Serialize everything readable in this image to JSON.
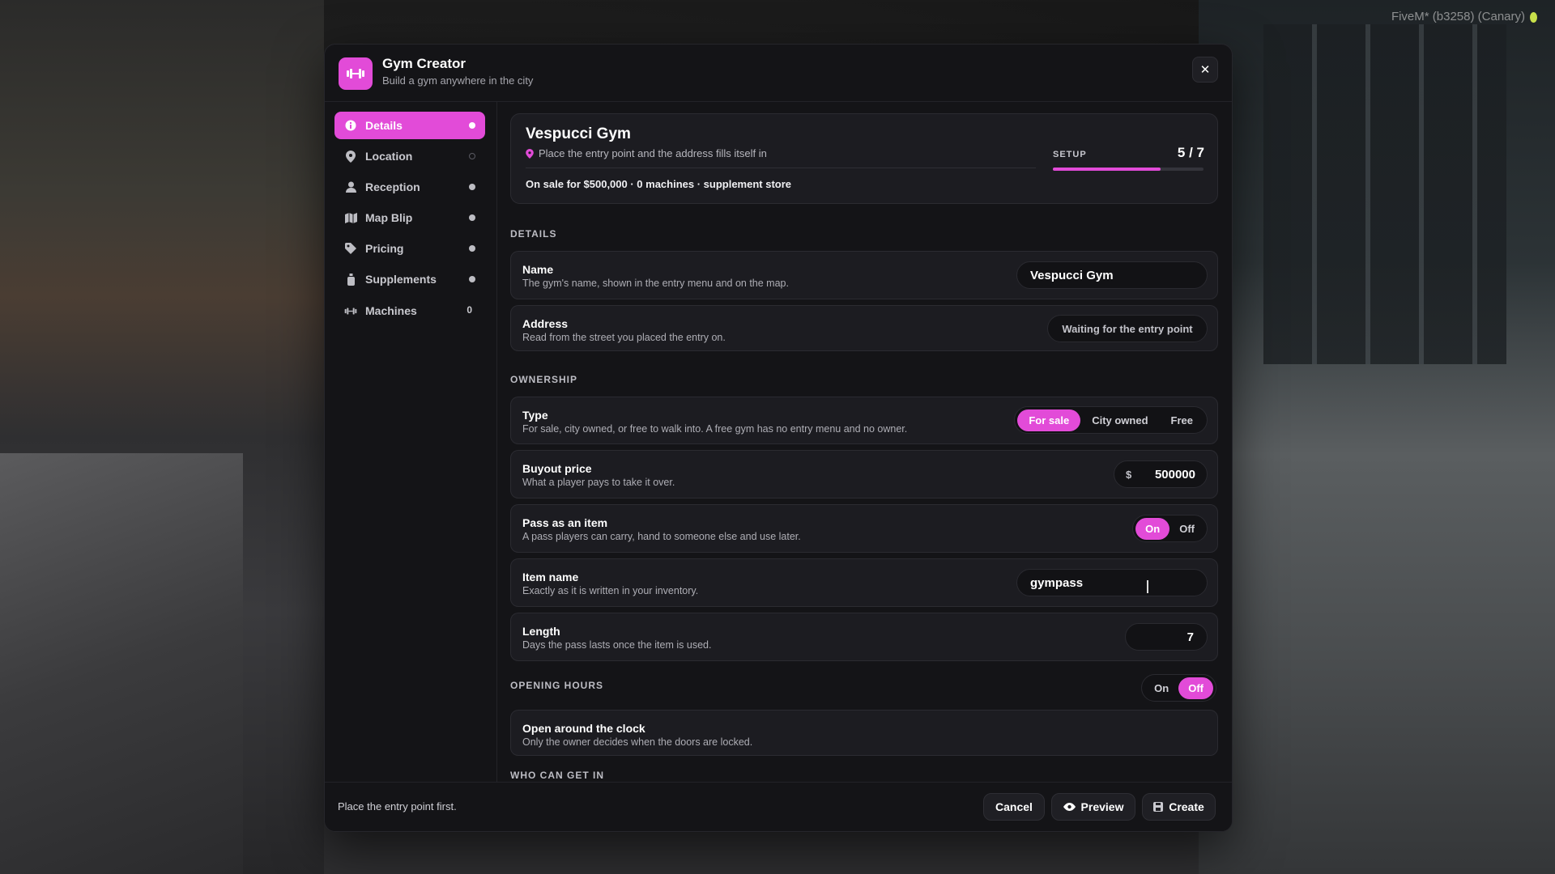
{
  "overlay": {
    "client": "FiveM* (b3258) (Canary)"
  },
  "header": {
    "logo_icon": "dumbbell-icon",
    "title": "Gym Creator",
    "subtitle": "Build a gym anywhere in the city",
    "close_label": "✕"
  },
  "sidebar": {
    "items": [
      {
        "label": "Details",
        "icon": "info-icon",
        "state": "active"
      },
      {
        "label": "Location",
        "icon": "pin-icon",
        "state": "empty"
      },
      {
        "label": "Reception",
        "icon": "person-icon",
        "state": "done"
      },
      {
        "label": "Map Blip",
        "icon": "map-icon",
        "state": "done"
      },
      {
        "label": "Pricing",
        "icon": "tag-icon",
        "state": "done"
      },
      {
        "label": "Supplements",
        "icon": "bottle-icon",
        "state": "done"
      },
      {
        "label": "Machines",
        "icon": "dumbbell-icon",
        "count": "0"
      }
    ]
  },
  "summary": {
    "title": "Vespucci Gym",
    "hint": "Place the entry point and the address fills itself in",
    "meta": "On sale for $500,000 · 0 machines · supplement store",
    "setup_label": "SETUP",
    "setup_count": "5 / 7",
    "progress": 0.714
  },
  "sections": {
    "details": "DETAILS",
    "ownership": "OWNERSHIP",
    "hours": "OPENING HOURS",
    "access": "WHO CAN GET IN"
  },
  "details": {
    "name": {
      "label": "Name",
      "desc": "The gym's name, shown in the entry menu and on the map.",
      "value": "Vespucci Gym"
    },
    "address": {
      "label": "Address",
      "desc": "Read from the street you placed the entry on.",
      "value": "Waiting for the entry point"
    }
  },
  "ownership": {
    "type": {
      "label": "Type",
      "desc": "For sale, city owned, or free to walk into. A free gym has no entry menu and no owner.",
      "options": [
        "For sale",
        "City owned",
        "Free"
      ],
      "selected": "For sale"
    },
    "buyout": {
      "label": "Buyout price",
      "desc": "What a player pays to take it over.",
      "currency": "$",
      "value": "500000"
    },
    "pass": {
      "label": "Pass as an item",
      "desc": "A pass players can carry, hand to someone else and use later.",
      "on": "On",
      "off": "Off",
      "selected": "On"
    },
    "item_name": {
      "label": "Item name",
      "desc": "Exactly as it is written in your inventory.",
      "value": "gympass"
    },
    "length": {
      "label": "Length",
      "desc": "Days the pass lasts once the item is used.",
      "value": "7"
    }
  },
  "hours": {
    "on": "On",
    "off": "Off",
    "selected": "Off",
    "always": {
      "label": "Open around the clock",
      "desc": "Only the owner decides when the doors are locked."
    }
  },
  "footer": {
    "message": "Place the entry point first.",
    "cancel": "Cancel",
    "preview": "Preview",
    "create": "Create"
  },
  "colors": {
    "accent": "#e24bd8",
    "panel": "#141417",
    "row": "#1c1c21"
  }
}
